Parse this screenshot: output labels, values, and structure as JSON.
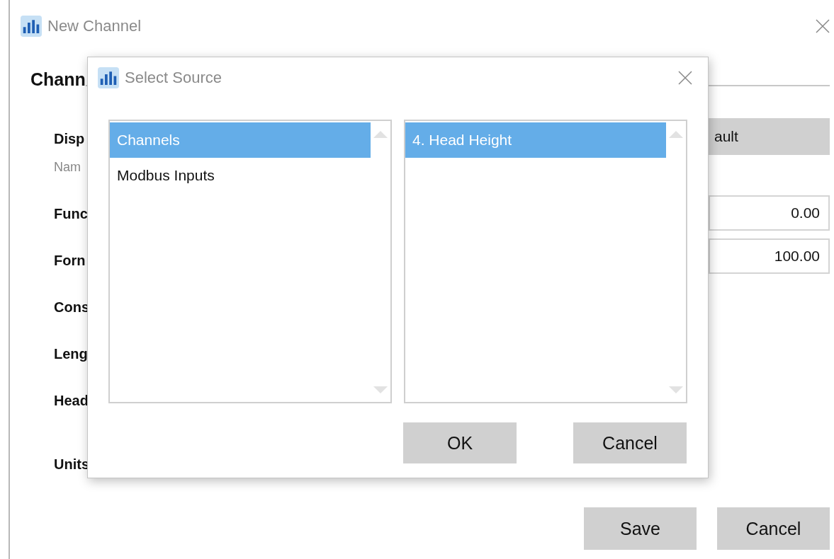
{
  "window": {
    "title": "New Channel",
    "heading": "Chann",
    "labels": [
      {
        "text": "Disp",
        "kind": "label"
      },
      {
        "text": "Nam",
        "kind": "hint"
      },
      {
        "text": "Func",
        "kind": "label"
      },
      {
        "text": "Forn",
        "kind": "label"
      },
      {
        "text": "Cons",
        "kind": "label"
      },
      {
        "text": "Leng",
        "kind": "label"
      },
      {
        "text": "Head",
        "kind": "label"
      },
      {
        "text": "Units",
        "kind": "label"
      }
    ],
    "default_button": "ault",
    "fields": [
      {
        "value": "0.00"
      },
      {
        "value": "100.00"
      }
    ],
    "buttons": [
      "Save",
      "Cancel"
    ]
  },
  "dialog": {
    "title": "Select Source",
    "lists": [
      {
        "items": [
          {
            "label": "Channels",
            "selected": true
          },
          {
            "label": "Modbus Inputs",
            "selected": false
          }
        ]
      },
      {
        "items": [
          {
            "label": "4. Head Height",
            "selected": true
          }
        ]
      }
    ],
    "buttons": [
      "OK",
      "Cancel"
    ]
  }
}
